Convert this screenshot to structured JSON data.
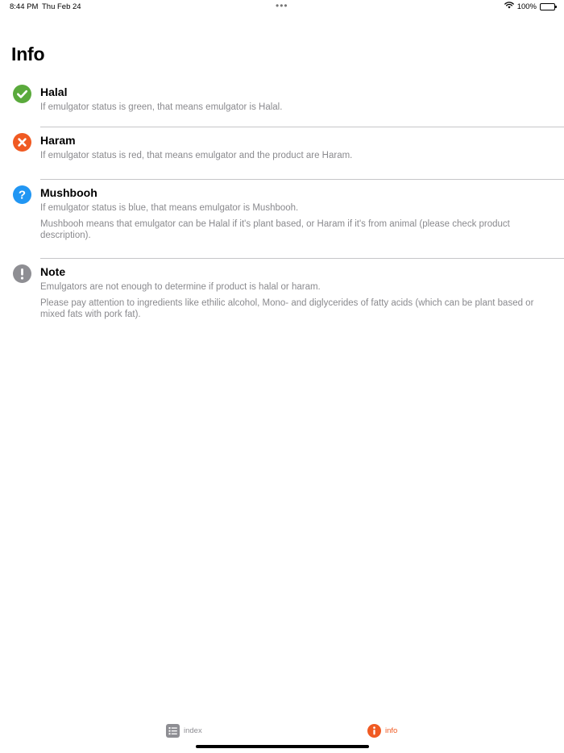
{
  "status_bar": {
    "time": "8:44 PM",
    "date": "Thu Feb 24",
    "dots": "•••",
    "battery": "100%",
    "icons": [
      "wifi-icon",
      "battery-icon"
    ]
  },
  "page": {
    "title": "Info"
  },
  "items": [
    {
      "id": "halal",
      "icon": "check-circle-icon",
      "color": "#5aaa3c",
      "title": "Halal",
      "lines": [
        "If emulgator status is green, that means emulgator is Halal."
      ]
    },
    {
      "id": "haram",
      "icon": "x-circle-icon",
      "color": "#f05a22",
      "title": "Haram",
      "lines": [
        "If emulgator status is red, that means emulgator and the product are Haram."
      ]
    },
    {
      "id": "mushbooh",
      "icon": "question-circle-icon",
      "color": "#2196f3",
      "title": "Mushbooh",
      "lines": [
        "If emulgator status is blue, that means emulgator is Mushbooh.",
        "Mushbooh means that emulgator can be Halal if it's plant based, or Haram if it's from animal (please check product description)."
      ]
    },
    {
      "id": "note",
      "icon": "exclamation-circle-icon",
      "color": "#8e8e93",
      "title": "Note",
      "lines": [
        "Emulgators are not enough to determine if product is halal or haram.",
        "Please pay attention to ingredients like ethilic alcohol, Mono- and diglycerides of fatty acids (which can be plant based or mixed fats with pork fat)."
      ]
    }
  ],
  "tab_bar": {
    "tabs": [
      {
        "label": "index",
        "icon": "list-icon",
        "selected": false
      },
      {
        "label": "info",
        "icon": "info-circle-icon",
        "selected": true
      }
    ],
    "accent": "#f05a22",
    "inactive": "#8e8e93"
  }
}
